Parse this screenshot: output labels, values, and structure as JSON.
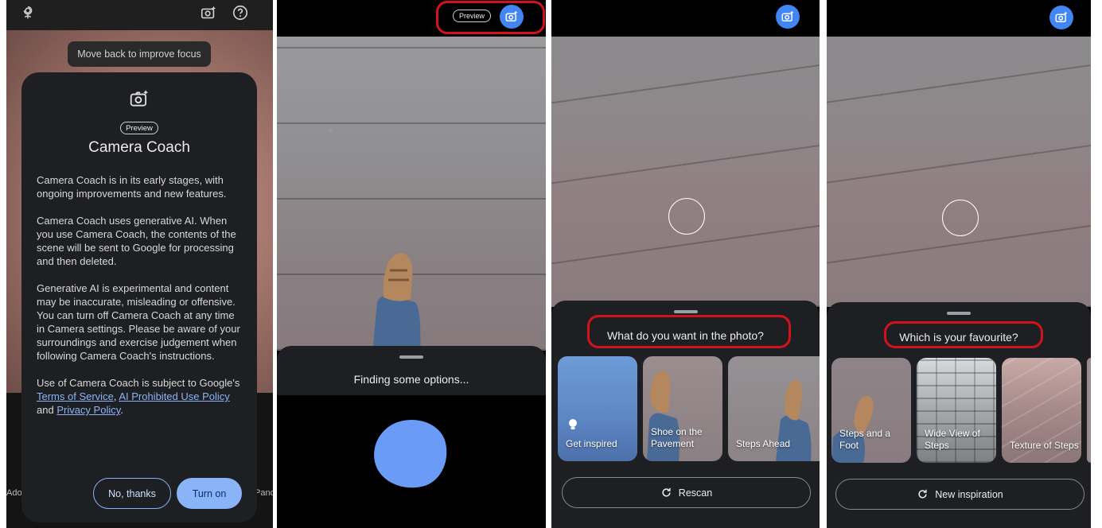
{
  "panel1": {
    "focus_tip": "Move back to improve focus",
    "dialog": {
      "preview_badge": "Preview",
      "title": "Camera Coach",
      "para1": "Camera Coach is in its early stages, with ongoing improvements and new features.",
      "para2": "Camera Coach uses generative AI. When you use Camera Coach, the contents of the scene will be sent to Google for processing and then deleted.",
      "para3": "Generative AI is experimental and content may be inaccurate, misleading or offensive. You can turn off Camera Coach at any time in Camera settings. Please be aware of your surroundings and exercise judgement when following Camera Coach's instructions.",
      "para4_prefix": "Use of Camera Coach is subject to Google's ",
      "link_terms": "Terms of Service",
      "para4_sep": ", ",
      "link_ai_policy": "AI Prohibited Use Policy",
      "para4_and": " and ",
      "link_privacy": "Privacy Policy",
      "para4_end": ".",
      "no_thanks": "No, thanks",
      "turn_on": "Turn on"
    },
    "edge_left": "Ado",
    "edge_right": "Pano"
  },
  "panel2": {
    "preview_badge": "Preview",
    "finding_text": "Finding some options..."
  },
  "panel3": {
    "question": "What do you want in the photo?",
    "options": [
      "Get inspired",
      "Shoe on the Pavement",
      "Steps Ahead"
    ],
    "rescan": "Rescan"
  },
  "panel4": {
    "question": "Which is your favourite?",
    "options": [
      "Steps and a Foot",
      "Wide View of Steps",
      "Texture of Steps"
    ],
    "new_inspiration": "New inspiration"
  },
  "colors": {
    "accent_blue": "#4285f4",
    "link_blue": "#8ab4f8",
    "highlight_red": "#d3131c",
    "sheet_bg": "#1e1f22"
  }
}
